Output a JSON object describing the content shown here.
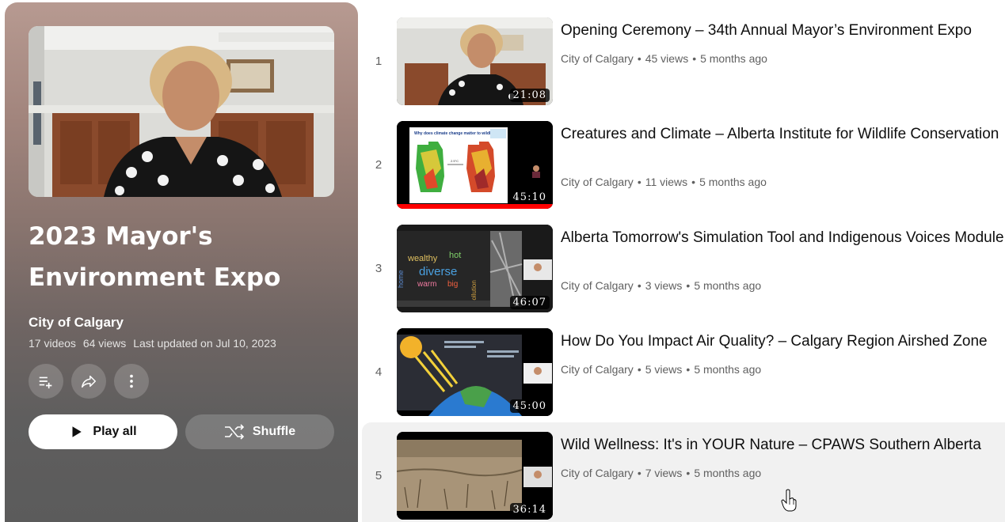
{
  "playlist": {
    "title": "2023 Mayor's Environment Expo",
    "owner": "City of Calgary",
    "video_count": "17 videos",
    "views": "64 views",
    "last_updated": "Last updated on Jul 10, 2023",
    "play_all_label": "Play all",
    "shuffle_label": "Shuffle",
    "icons": [
      "add-to-queue-icon",
      "share-icon",
      "more-vert-icon",
      "play-icon",
      "shuffle-icon"
    ]
  },
  "videos": [
    {
      "index": "1",
      "title": "Opening Ceremony – 34th Annual Mayor’s Environment Expo",
      "channel": "City of Calgary",
      "views": "45 views",
      "age": "5 months ago",
      "duration": "21:08"
    },
    {
      "index": "2",
      "title": "Creatures and Climate – Alberta Institute for Wildlife Conservation",
      "channel": "City of Calgary",
      "views": "11 views",
      "age": "5 months ago",
      "duration": "45:10"
    },
    {
      "index": "3",
      "title": "Alberta Tomorrow's Simulation Tool and Indigenous Voices Module",
      "channel": "City of Calgary",
      "views": "3 views",
      "age": "5 months ago",
      "duration": "46:07"
    },
    {
      "index": "4",
      "title": "How Do You Impact Air Quality? – Calgary Region Airshed Zone",
      "channel": "City of Calgary",
      "views": "5 views",
      "age": "5 months ago",
      "duration": "45:00"
    },
    {
      "index": "5",
      "title": "Wild Wellness: It's in YOUR Nature – CPAWS Southern Alberta",
      "channel": "City of Calgary",
      "views": "7 views",
      "age": "5 months ago",
      "duration": "36:14"
    }
  ],
  "thumb_texts": {
    "v2_slide_title": "Why does climate change matter to wildlife?",
    "v2_arrow": "2.5°C",
    "v3_words": [
      "wealthy",
      "hot",
      "diverse",
      "warm",
      "big",
      "home",
      "pollution"
    ]
  },
  "colors": {
    "accent_red": "#ff0000",
    "text_primary": "#0f0f0f",
    "text_secondary": "#606060",
    "hover_bg": "#f1f1f1"
  }
}
